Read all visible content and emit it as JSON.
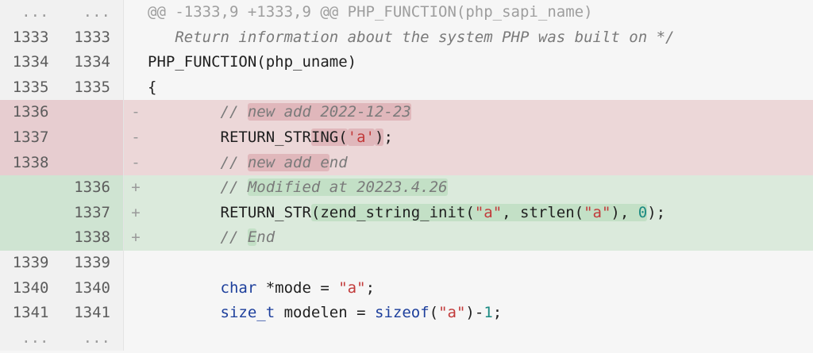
{
  "hunk": {
    "old_ln": "...",
    "new_ln": "...",
    "text": "@@ -1333,9 +1333,9 @@ PHP_FUNCTION(php_sapi_name)"
  },
  "lines": [
    {
      "old": "1333",
      "new": "1333",
      "marker": "",
      "code": "   Return information about the system PHP was built on */"
    },
    {
      "old": "1334",
      "new": "1334",
      "marker": "",
      "code": "PHP_FUNCTION(php_uname)"
    },
    {
      "old": "1335",
      "new": "1335",
      "marker": "",
      "code": "{"
    },
    {
      "old": "1336",
      "new": "",
      "marker": "-",
      "code_pre": "        // ",
      "code_hl": "new add 2022-12-23",
      "code_post": ""
    },
    {
      "old": "1337",
      "new": "",
      "marker": "-",
      "code_pre": "        RETURN_STR",
      "code_hl": "ING(",
      "code_str": "'a'",
      "code_hl2": ")",
      "code_post": ";"
    },
    {
      "old": "1338",
      "new": "",
      "marker": "-",
      "code_pre": "        // ",
      "code_hl": "new add e",
      "code_post": "nd"
    },
    {
      "old": "",
      "new": "1336",
      "marker": "+",
      "code_pre": "        // ",
      "code_hl": "Modified at 20223.4.26",
      "code_post": ""
    },
    {
      "old": "",
      "new": "1337",
      "marker": "+",
      "code_pre": "        RETURN_STR",
      "code_hl": "(zend_string_init(",
      "code_str": "\"a\"",
      "code_mid": ", strlen(",
      "code_str2": "\"a\"",
      "code_mid2": "), ",
      "code_num": "0",
      "code_hl2": ")",
      "code_post": ");"
    },
    {
      "old": "",
      "new": "1338",
      "marker": "+",
      "code_pre": "        // ",
      "code_hl": "E",
      "code_post": "nd"
    },
    {
      "old": "1339",
      "new": "1339",
      "marker": "",
      "code": ""
    },
    {
      "old": "1340",
      "new": "1340",
      "marker": "",
      "code_kw": "char",
      "code_after_kw": " *mode = ",
      "code_str": "\"a\"",
      "code_post": ";"
    },
    {
      "old": "1341",
      "new": "1341",
      "marker": "",
      "code_kw": "size_t",
      "code_after_kw": " modelen = ",
      "code_kw2": "sizeof",
      "code_paren": "(",
      "code_str": "\"a\"",
      "code_close": ")-",
      "code_num": "1",
      "code_post": ";"
    }
  ],
  "fold": {
    "old_ln": "...",
    "new_ln": "..."
  }
}
